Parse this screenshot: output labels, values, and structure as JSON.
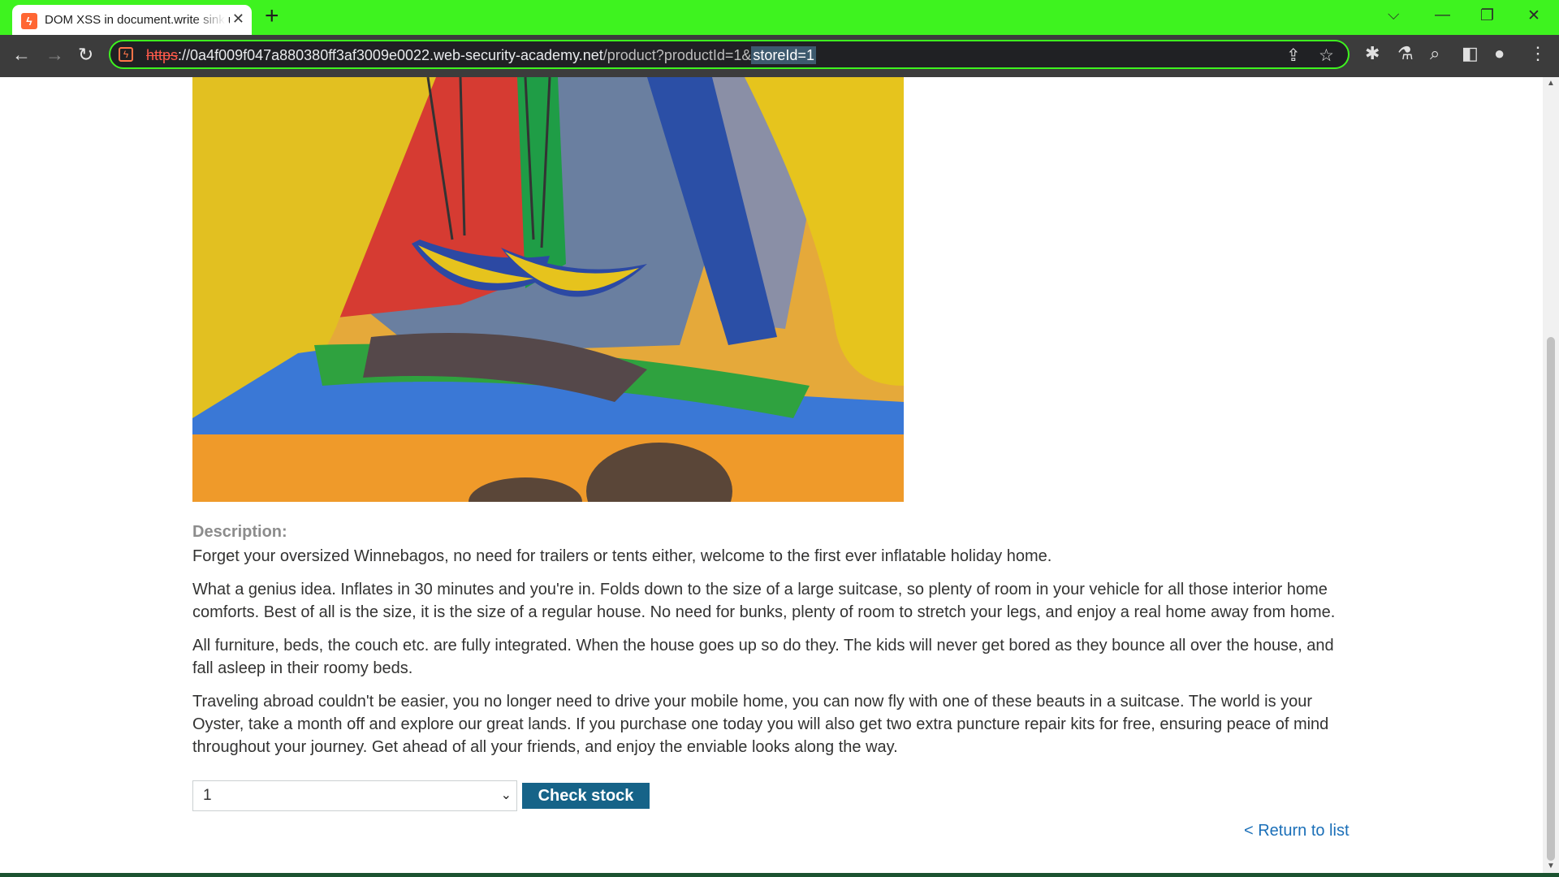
{
  "browser": {
    "tab_title": "DOM XSS in document.write sink using source location.search inside a select element",
    "url": {
      "scheme": "https",
      "host": "://0a4f009f047a880380ff3af3009e0022.web-security-academy.net",
      "path": "/product?productId=1&",
      "selected": "storeId=1"
    },
    "accent_color": "#3ef31f"
  },
  "product": {
    "description_label": "Description:",
    "paragraphs": [
      "Forget your oversized Winnebagos, no need for trailers or tents either, welcome to the first ever inflatable holiday home.",
      "What a genius idea. Inflates in 30 minutes and you're in. Folds down to the size of a large suitcase, so plenty of room in your vehicle for all those interior home comforts. Best of all is the size, it is the size of a regular house. No need for bunks, plenty of room to stretch your legs, and enjoy a real home away from home.",
      "All furniture, beds, the couch etc. are fully integrated. When the house goes up so do they. The kids will never get bored as they bounce all over the house, and fall asleep in their roomy beds.",
      "Traveling abroad couldn't be easier, you no longer need to drive your mobile home, you can now fly with one of these beauts in a suitcase. The world is your Oyster, take a month off and explore our great lands. If you purchase one today you will also get two extra puncture repair kits for free, ensuring peace of mind throughout your journey. Get ahead of all your friends, and enjoy the enviable looks along the way."
    ],
    "store_select_value": "1",
    "check_stock_label": "Check stock",
    "return_link": "< Return to list"
  }
}
